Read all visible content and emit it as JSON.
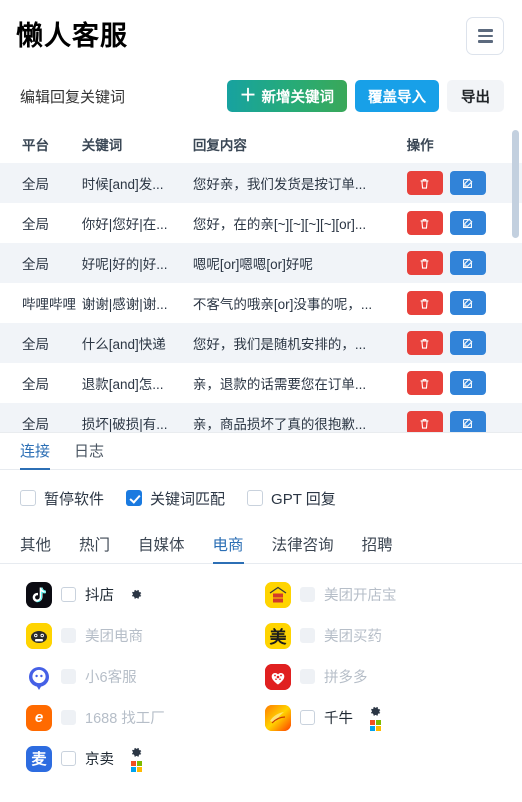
{
  "header": {
    "brand": "懒人客服",
    "menu_icon": "hamburger-icon"
  },
  "toolbar": {
    "title": "编辑回复关键词",
    "add_label": "新增关键词",
    "add_plus": "＋",
    "import_label": "覆盖导入",
    "export_label": "导出"
  },
  "table": {
    "columns": [
      "平台",
      "关键词",
      "回复内容",
      "操作"
    ],
    "rows": [
      {
        "platform": "全局",
        "keyword": "时候[and]发...",
        "reply": "您好亲，我们发货是按订单..."
      },
      {
        "platform": "全局",
        "keyword": "你好|您好|在...",
        "reply": "您好，在的亲[~][~][~][~][or]..."
      },
      {
        "platform": "全局",
        "keyword": "好呢|好的|好...",
        "reply": "嗯呢[or]嗯嗯[or]好呢"
      },
      {
        "platform": "哔哩哔哩",
        "keyword": "谢谢|感谢|谢...",
        "reply": "不客气的哦亲[or]没事的呢，..."
      },
      {
        "platform": "全局",
        "keyword": "什么[and]快递",
        "reply": "您好，我们是随机安排的，..."
      },
      {
        "platform": "全局",
        "keyword": "退款[and]怎...",
        "reply": "亲，退款的话需要您在订单..."
      },
      {
        "platform": "全局",
        "keyword": "损坏|破损|有...",
        "reply": "亲，商品损坏了真的很抱歉..."
      }
    ],
    "delete_icon": "trash-icon",
    "edit_icon": "edit-pencil-icon"
  },
  "connect_tabs": {
    "items": [
      {
        "label": "连接",
        "active": true
      },
      {
        "label": "日志",
        "active": false
      }
    ]
  },
  "options": [
    {
      "label": "暂停软件",
      "checked": false
    },
    {
      "label": "关键词匹配",
      "checked": true
    },
    {
      "label": "GPT 回复",
      "checked": false
    }
  ],
  "category_tabs": {
    "items": [
      {
        "label": "其他",
        "active": false
      },
      {
        "label": "热门",
        "active": false
      },
      {
        "label": "自媒体",
        "active": false
      },
      {
        "label": "电商",
        "active": true
      },
      {
        "label": "法律咨询",
        "active": false
      },
      {
        "label": "招聘",
        "active": false
      }
    ]
  },
  "platforms": [
    {
      "label": "抖店",
      "enabled": true,
      "checked": false,
      "gear": true,
      "ms_logo": false,
      "logo": "douyin-logo",
      "logo_text": "♪"
    },
    {
      "label": "美团开店宝",
      "enabled": false,
      "checked": false,
      "gear": false,
      "ms_logo": false,
      "logo": "meituan-kaidianbao-logo",
      "logo_text": "美团\n开店宝"
    },
    {
      "label": "美团电商",
      "enabled": false,
      "checked": false,
      "gear": false,
      "ms_logo": false,
      "logo": "meituan-logo",
      "logo_text": ""
    },
    {
      "label": "美团买药",
      "enabled": false,
      "checked": false,
      "gear": false,
      "ms_logo": false,
      "logo": "meituan-maiyao-logo",
      "logo_text": "美"
    },
    {
      "label": "小6客服",
      "enabled": false,
      "checked": false,
      "gear": false,
      "ms_logo": false,
      "logo": "xiao6-logo",
      "logo_text": ""
    },
    {
      "label": "拼多多",
      "enabled": false,
      "checked": false,
      "gear": false,
      "ms_logo": false,
      "logo": "pinduoduo-logo",
      "logo_text": ""
    },
    {
      "label": "1688 找工厂",
      "enabled": false,
      "checked": false,
      "gear": false,
      "ms_logo": false,
      "logo": "alibaba-1688-logo",
      "logo_text": "e"
    },
    {
      "label": "千牛",
      "enabled": true,
      "checked": false,
      "gear": true,
      "ms_logo": true,
      "logo": "qianniu-logo",
      "logo_text": ""
    },
    {
      "label": "京卖",
      "enabled": true,
      "checked": false,
      "gear": true,
      "ms_logo": true,
      "logo": "jingmai-logo",
      "logo_text": "麦"
    }
  ],
  "colors": {
    "accent_blue": "#2c6fb5",
    "checkbox_blue": "#1a7ae0",
    "delete_red": "#e8413b",
    "edit_blue": "#3183d8",
    "import_blue": "#18a0e8",
    "add_green_start": "#17a2a0",
    "add_green_end": "#3aa859"
  }
}
